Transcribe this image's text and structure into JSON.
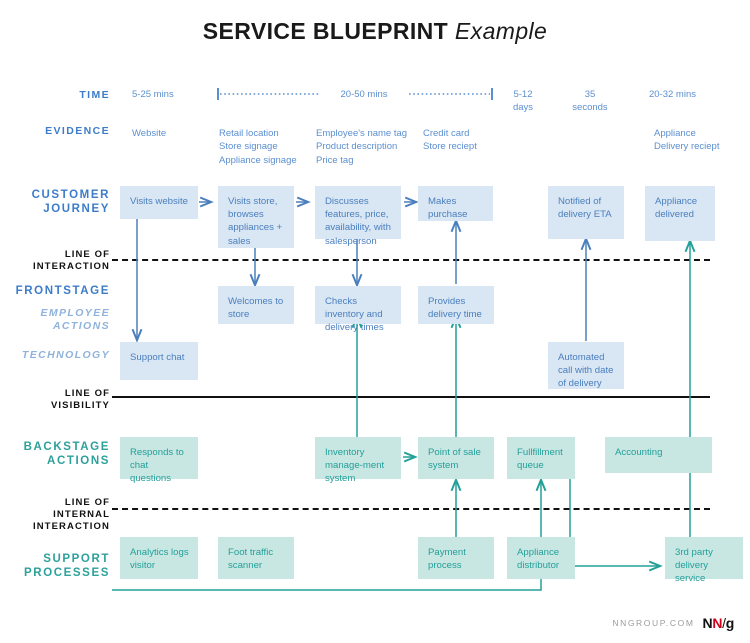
{
  "title": {
    "main": "SERVICE BLUEPRINT",
    "italic": "Example"
  },
  "colors": {
    "blue_fill": "#d9e6f4",
    "blue_text": "#4a7fbe",
    "blue_label": "#3d7cc9",
    "teal_fill": "#c8e6e2",
    "teal_text": "#23a09a",
    "teal_label": "#2da19a",
    "line": "#111111",
    "soft_blue": "#8fb3da",
    "accent_red": "#d0021b"
  },
  "rows": {
    "time_label": "TIME",
    "evidence_label": "EVIDENCE",
    "customer_journey_label": "CUSTOMER\nJOURNEY",
    "line_of_interaction_label": "LINE OF\nINTERACTION",
    "frontstage_label": "FRONTSTAGE",
    "employee_actions_label": "EMPLOYEE\nACTIONS",
    "technology_label": "TECHNOLOGY",
    "line_of_visibility_label": "LINE OF\nVISIBILITY",
    "backstage_label": "BACKSTAGE\nACTIONS",
    "line_of_internal_interaction_label": "LINE OF\nINTERNAL\nINTERACTION",
    "support_label": "SUPPORT\nPROCESSES"
  },
  "time": [
    {
      "text": "5-25 mins"
    },
    {
      "text": "20-50 mins"
    },
    {
      "text": "5-12\ndays"
    },
    {
      "text": "35\nseconds"
    },
    {
      "text": "20-32 mins"
    }
  ],
  "evidence": [
    {
      "text": "Website"
    },
    {
      "text": "Retail location\nStore signage\nAppliance signage"
    },
    {
      "text": "Employee's name tag\nProduct description\nPrice tag"
    },
    {
      "text": "Credit card\nStore reciept"
    },
    {
      "text": "Appliance\nDelivery reciept"
    }
  ],
  "customer_journey": [
    {
      "text": "Visits website"
    },
    {
      "text": "Visits store, browses appliances + sales"
    },
    {
      "text": "Discusses features, price, availability, with salesperson"
    },
    {
      "text": "Makes purchase"
    },
    {
      "text": "Notified of delivery ETA"
    },
    {
      "text": "Appliance delivered"
    }
  ],
  "employee_actions": [
    {
      "text": "Welcomes to store"
    },
    {
      "text": "Checks inventory and delivery times"
    },
    {
      "text": "Provides delivery time"
    }
  ],
  "technology": [
    {
      "text": "Support chat"
    },
    {
      "text": "Automated call with date of delivery"
    }
  ],
  "backstage_actions": [
    {
      "text": "Responds to chat questions"
    },
    {
      "text": "Inventory manage-ment system"
    },
    {
      "text": "Point of sale system"
    },
    {
      "text": "Fullfillment queue"
    },
    {
      "text": "Accounting"
    }
  ],
  "support_processes": [
    {
      "text": "Analytics logs visitor"
    },
    {
      "text": "Foot traffic scanner"
    },
    {
      "text": "Payment process"
    },
    {
      "text": "Appliance distributor"
    },
    {
      "text": "3rd party delivery service"
    }
  ],
  "footer": {
    "domain": "NNGROUP.COM",
    "logo_n1": "N",
    "logo_n2": "N",
    "logo_slash": "/",
    "logo_g": "g"
  }
}
